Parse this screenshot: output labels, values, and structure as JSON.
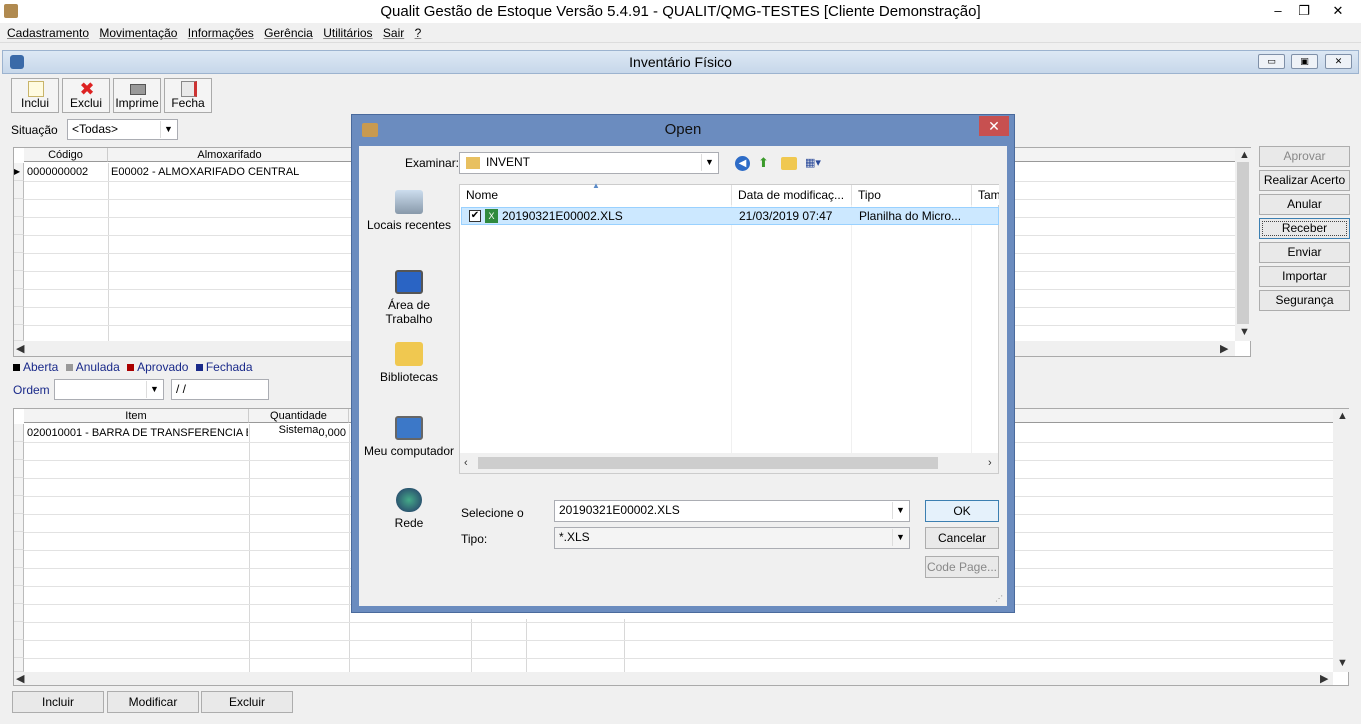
{
  "window": {
    "title": "Qualit Gestão de Estoque Versão 5.4.91 - QUALIT/QMG-TESTES [Cliente Demonstração]",
    "minimize": "–",
    "restore": "❐",
    "close": "✕"
  },
  "menu": [
    "Cadastramento",
    "Movimentação",
    "Informações",
    "Gerência",
    "Utilitários",
    "Sair",
    "?"
  ],
  "inventory_window": {
    "title": "Inventário Físico",
    "controls": [
      "▭",
      "▣",
      "✕"
    ]
  },
  "toolbar": {
    "incluir": "Inclui",
    "excluir": "Exclui",
    "imprimir": "Imprime",
    "fechar": "Fecha"
  },
  "filter": {
    "situacao_label": "Situação",
    "situacao_value": "<Todas>"
  },
  "top_grid": {
    "headers": [
      "Código",
      "Almoxarifado"
    ],
    "rows": [
      {
        "codigo": "0000000002",
        "almoxarifado": "E00002 - ALMOXARIFADO CENTRAL"
      }
    ]
  },
  "legend": [
    "Aberta",
    "Anulada",
    "Aprovado",
    "Fechada"
  ],
  "ordem": {
    "label": "Ordem",
    "value": "",
    "date": "/ /"
  },
  "bottom_grid": {
    "headers": [
      "Item",
      "Quantidade Sistema"
    ],
    "rows": [
      {
        "item": "020010001 - BARRA DE TRANSFERENCIA B",
        "quantidade": "0,000"
      }
    ]
  },
  "side_buttons": [
    "Aprovar",
    "Realizar Acerto",
    "Anular",
    "Receber",
    "Enviar",
    "Importar",
    "Segurança"
  ],
  "bottom_buttons": [
    "Incluir",
    "Modificar",
    "Excluir"
  ],
  "dialog": {
    "title": "Open",
    "close": "✕",
    "look_in_label": "Examinar:",
    "look_in_value": "INVENT",
    "places": [
      "Locais recentes",
      "Área de Trabalho",
      "Bibliotecas",
      "Meu computador",
      "Rede"
    ],
    "columns": [
      "Nome",
      "Data de modificaç...",
      "Tipo",
      "Tam"
    ],
    "files": [
      {
        "name": "20190321E00002.XLS",
        "date": "21/03/2019 07:47",
        "type": "Planilha do Micro..."
      }
    ],
    "filename_label": "Selecione o",
    "filename_value": "20190321E00002.XLS",
    "type_label": "Tipo:",
    "type_value": "*.XLS",
    "ok": "OK",
    "cancel": "Cancelar",
    "codepage": "Code Page..."
  }
}
